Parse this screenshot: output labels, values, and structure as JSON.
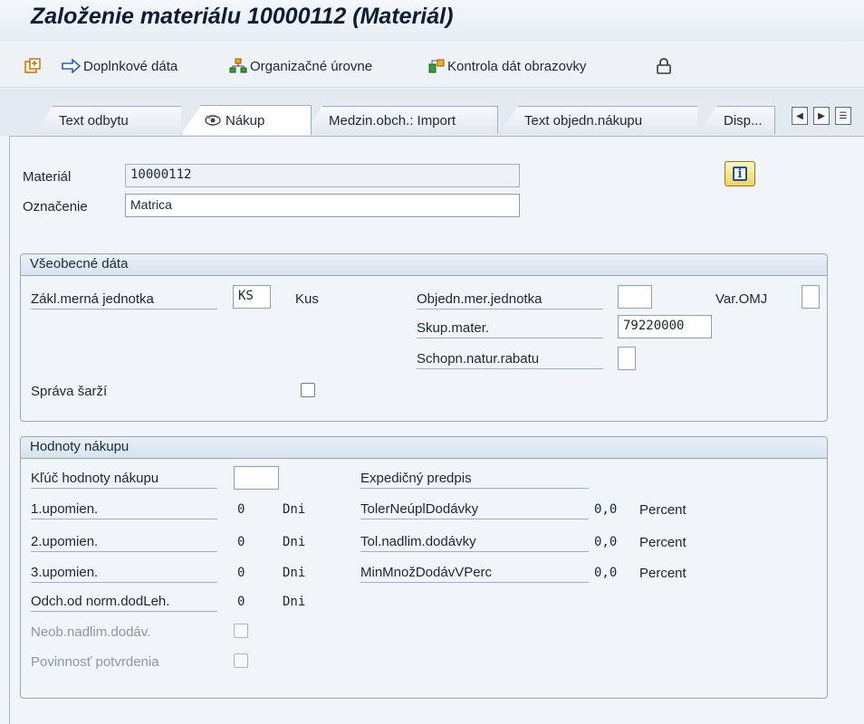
{
  "window": {
    "title": "Založenie materiálu 10000112 (Materiál)"
  },
  "toolbar": {
    "additional_data": "Doplnkové dáta",
    "org_levels": "Organizačné úrovne",
    "check_data": "Kontrola dát obrazovky"
  },
  "tabs": [
    {
      "label": "Text odbytu",
      "active": false
    },
    {
      "label": "Nákup",
      "active": true
    },
    {
      "label": "Medzin.obch.: Import",
      "active": false
    },
    {
      "label": "Text objedn.nákupu",
      "active": false
    },
    {
      "label": "Disp...",
      "active": false
    }
  ],
  "header": {
    "material_label": "Materiál",
    "material_value": "10000112",
    "description_label": "Označenie",
    "description_value": "Matrica"
  },
  "general": {
    "title": "Všeobecné dáta",
    "base_uom_label": "Zákl.merná jednotka",
    "base_uom_value": "KS",
    "base_uom_text": "Kus",
    "order_unit_label": "Objedn.mer.jednotka",
    "order_unit_value": "",
    "var_omj_label": "Var.OMJ",
    "var_omj_value": "",
    "material_group_label": "Skup.mater.",
    "material_group_value": "79220000",
    "natural_rebate_label": "Schopn.natur.rabatu",
    "natural_rebate_value": "",
    "batch_mgmt_label": "Správa šarží",
    "batch_mgmt_checked": false
  },
  "purchasing": {
    "title": "Hodnoty nákupu",
    "key_label": "Kľúč hodnoty nákupu",
    "key_value": "",
    "shipping_instr_label": "Expedičný predpis",
    "reminders": [
      {
        "label": "1.upomien.",
        "value": "0",
        "unit": "Dni"
      },
      {
        "label": "2.upomien.",
        "value": "0",
        "unit": "Dni"
      },
      {
        "label": "3.upomien.",
        "value": "0",
        "unit": "Dni"
      },
      {
        "label": "Odch.od norm.dodLeh.",
        "value": "0",
        "unit": "Dni"
      }
    ],
    "tolerances": [
      {
        "label": "TolerNeúplDodávky",
        "value": "0,0",
        "unit": "Percent"
      },
      {
        "label": "Tol.nadlim.dodávky",
        "value": "0,0",
        "unit": "Percent"
      },
      {
        "label": "MinMnožDodávVPerc",
        "value": "0,0",
        "unit": "Percent"
      }
    ],
    "unlimited_label": "Neob.nadlim.dodáv.",
    "unlimited_checked": false,
    "ack_required_label": "Povinnosť potvrdenia",
    "ack_required_checked": false
  },
  "colors": {
    "accent": "#24528e",
    "title": "#0e1d33",
    "group_border": "#93a8bf"
  },
  "icons": [
    "create-icon",
    "arrow-right-icon",
    "org-levels-icon",
    "check-data-icon",
    "lock-icon",
    "info-icon",
    "tab-left-icon",
    "tab-right-icon",
    "tab-list-icon"
  ]
}
